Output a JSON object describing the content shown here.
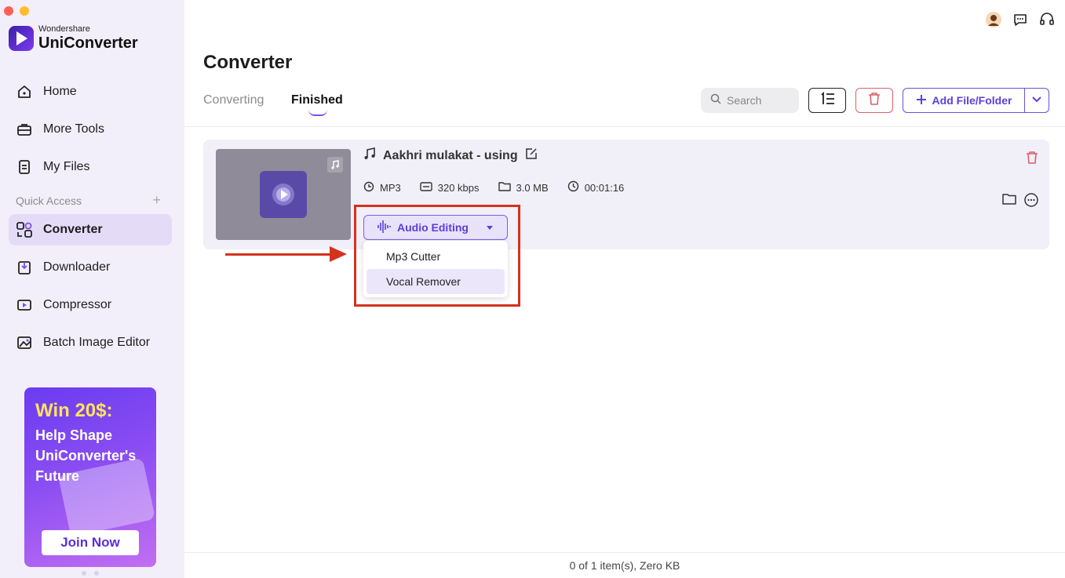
{
  "colors": {
    "accent": "#6b4fe0",
    "danger": "#d9616b",
    "sidebar_bg": "#f3effa",
    "annotation": "#d4321d"
  },
  "brand": {
    "small": "Wondershare",
    "big": "UniConverter"
  },
  "sidebar": {
    "items": [
      {
        "label": "Home",
        "icon": "home-icon"
      },
      {
        "label": "More Tools",
        "icon": "toolbox-icon"
      },
      {
        "label": "My Files",
        "icon": "files-icon"
      },
      {
        "label": "Converter",
        "icon": "converter-icon",
        "active": true
      },
      {
        "label": "Downloader",
        "icon": "download-icon"
      },
      {
        "label": "Compressor",
        "icon": "compress-icon"
      },
      {
        "label": "Batch Image Editor",
        "icon": "image-edit-icon"
      }
    ],
    "quick_access": "Quick Access"
  },
  "promo": {
    "headline": "Win 20$:",
    "body": "Help Shape UniConverter's Future",
    "cta": "Join Now"
  },
  "header": {
    "title": "Converter",
    "tabs": [
      "Converting",
      "Finished"
    ],
    "active_tab": "Finished"
  },
  "toolbar": {
    "search_placeholder": "Search",
    "add_label": "Add File/Folder"
  },
  "file": {
    "name": "Aakhri mulakat - using",
    "format": "MP3",
    "bitrate": "320 kbps",
    "size": "3.0 MB",
    "duration": "00:01:16"
  },
  "audio_editing": {
    "label": "Audio Editing",
    "options": [
      "Mp3 Cutter",
      "Vocal Remover"
    ],
    "highlighted": "Vocal Remover"
  },
  "footer": {
    "status": "0 of 1 item(s), Zero KB"
  }
}
